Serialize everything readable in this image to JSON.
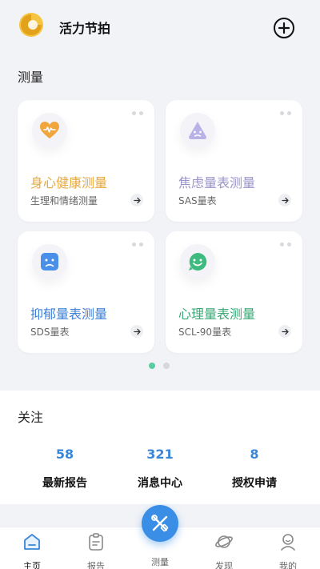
{
  "header": {
    "title": "活力节拍"
  },
  "section": {
    "title": "测量"
  },
  "cards": [
    {
      "title": "身心健康测量",
      "subtitle": "生理和情绪测量",
      "icon": "heart-wave-icon",
      "color": "#e8a83a"
    },
    {
      "title": "焦虑量表测量",
      "subtitle": "SAS量表",
      "icon": "anxiety-face-icon",
      "color": "#9a94c9"
    },
    {
      "title": "抑郁量表测量",
      "subtitle": "SDS量表",
      "icon": "sad-face-icon",
      "color": "#3d7fd6"
    },
    {
      "title": "心理量表测量",
      "subtitle": "SCL-90量表",
      "icon": "smile-chat-icon",
      "color": "#3aa876"
    }
  ],
  "pager": {
    "active": 0,
    "count": 2
  },
  "follow": {
    "title": "关注",
    "stats": [
      {
        "value": "58",
        "label": "最新报告"
      },
      {
        "value": "321",
        "label": "消息中心"
      },
      {
        "value": "8",
        "label": "授权申请"
      }
    ]
  },
  "tabbar": {
    "items": [
      {
        "label": "主页",
        "icon": "home-icon"
      },
      {
        "label": "报告",
        "icon": "clipboard-icon"
      },
      {
        "label": "测量",
        "icon": "measure-icon"
      },
      {
        "label": "发现",
        "icon": "planet-icon"
      },
      {
        "label": "我的",
        "icon": "user-icon"
      }
    ]
  }
}
